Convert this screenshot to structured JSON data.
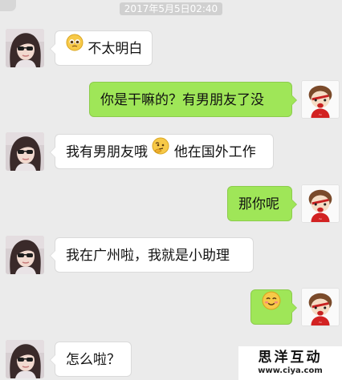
{
  "chat": {
    "timestamp": "2017年5月5日02:40",
    "messages": [
      {
        "side": "incoming",
        "emoji": "pleading-face-emoji",
        "text": "不太明白"
      },
      {
        "side": "outgoing",
        "text": "你是干嘛的？有男朋友了没"
      },
      {
        "side": "incoming",
        "text_before": "我有男朋友哦",
        "emoji": "thinking-face-emoji",
        "text_after": "他在国外工作"
      },
      {
        "side": "outgoing",
        "text": "那你呢"
      },
      {
        "side": "incoming",
        "text": "我在广州啦，我就是小助理"
      },
      {
        "side": "outgoing",
        "emoji": "blushing-smile-emoji"
      },
      {
        "side": "incoming",
        "text": "怎么啦？"
      }
    ]
  },
  "watermark": {
    "title": "思洋互动",
    "url": "www.ciya.com"
  },
  "colors": {
    "background": "#ebebeb",
    "outgoing_bubble": "#9fe658",
    "incoming_bubble": "#ffffff",
    "timestamp_bg": "#d0d0d0"
  }
}
